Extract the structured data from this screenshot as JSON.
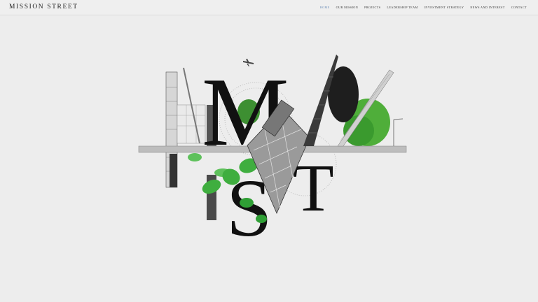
{
  "brand": {
    "name": "MISSION STREET"
  },
  "nav": {
    "items": [
      {
        "label": "HOME",
        "active": true
      },
      {
        "label": "OUR MISSION",
        "active": false
      },
      {
        "label": "PROJECTS",
        "active": false
      },
      {
        "label": "LEADERSHIP TEAM",
        "active": false
      },
      {
        "label": "INVESTMENT STRATEGY",
        "active": false
      },
      {
        "label": "NEWS AND INTEREST",
        "active": false
      },
      {
        "label": "CONTACT",
        "active": false
      }
    ]
  },
  "hero": {
    "letters": [
      "M",
      "S",
      "T"
    ],
    "colors": {
      "background": "#ededed",
      "accent": "#6d8fb8",
      "green": "#3fae3f",
      "ink": "#111111"
    }
  }
}
